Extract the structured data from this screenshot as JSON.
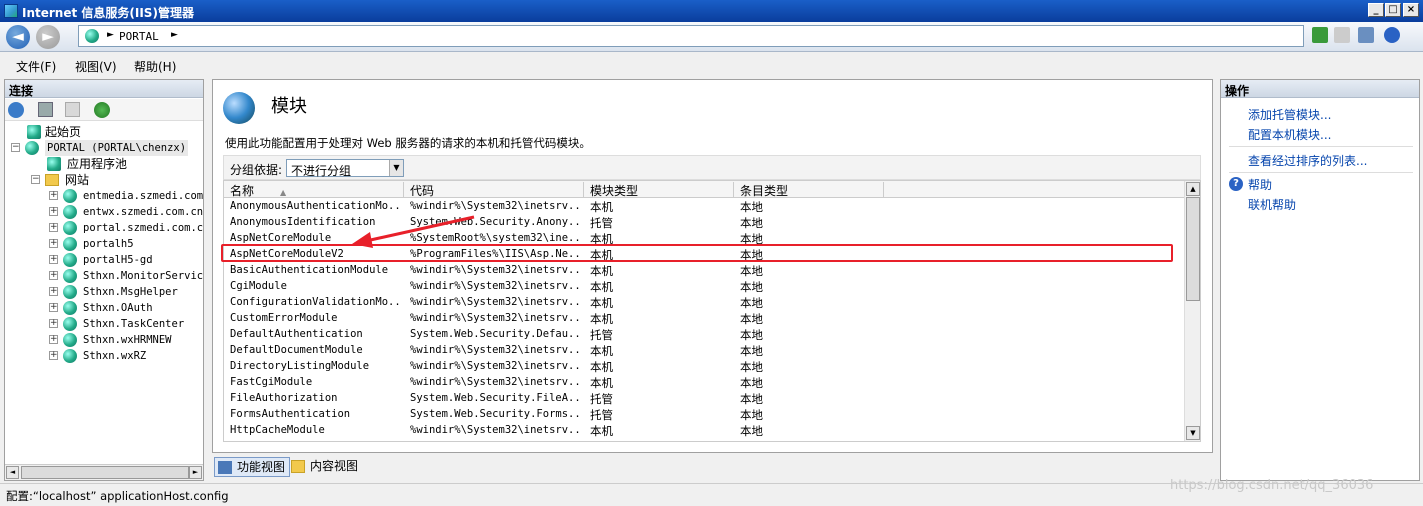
{
  "window": {
    "title": "Internet 信息服务(IIS)管理器"
  },
  "navbar": {
    "path": "PORTAL"
  },
  "menu": {
    "file": "文件(F)",
    "view": "视图(V)",
    "help": "帮助(H)"
  },
  "connections": {
    "header": "连接",
    "start_page": "起始页",
    "server": "PORTAL (PORTAL\\chenzx)",
    "app_pools": "应用程序池",
    "sites": "网站",
    "site_items": [
      "entmedia.szmedi.com.",
      "entwx.szmedi.com.cn",
      "portal.szmedi.com.cn",
      "portalh5",
      "portalH5-gd",
      "Sthxn.MonitorService",
      "Sthxn.MsgHelper",
      "Sthxn.OAuth",
      "Sthxn.TaskCenter",
      "Sthxn.wxHRMNEW",
      "Sthxn.wxRZ"
    ]
  },
  "page": {
    "title": "模块",
    "description": "使用此功能配置用于处理对 Web 服务器的请求的本机和托管代码模块。",
    "group_label": "分组依据:",
    "group_value": "不进行分组"
  },
  "grid": {
    "headers": [
      "名称",
      "代码",
      "模块类型",
      "条目类型"
    ],
    "rows": [
      [
        "AnonymousAuthenticationMo...",
        "%windir%\\System32\\inetsrv...",
        "本机",
        "本地"
      ],
      [
        "AnonymousIdentification",
        "System.Web.Security.Anony...",
        "托管",
        "本地"
      ],
      [
        "AspNetCoreModule",
        "%SystemRoot%\\system32\\ine...",
        "本机",
        "本地"
      ],
      [
        "AspNetCoreModuleV2",
        "%ProgramFiles%\\IIS\\Asp.Ne...",
        "本机",
        "本地"
      ],
      [
        "BasicAuthenticationModule",
        "%windir%\\System32\\inetsrv...",
        "本机",
        "本地"
      ],
      [
        "CgiModule",
        "%windir%\\System32\\inetsrv...",
        "本机",
        "本地"
      ],
      [
        "ConfigurationValidationMo...",
        "%windir%\\System32\\inetsrv...",
        "本机",
        "本地"
      ],
      [
        "CustomErrorModule",
        "%windir%\\System32\\inetsrv...",
        "本机",
        "本地"
      ],
      [
        "DefaultAuthentication",
        "System.Web.Security.Defau...",
        "托管",
        "本地"
      ],
      [
        "DefaultDocumentModule",
        "%windir%\\System32\\inetsrv...",
        "本机",
        "本地"
      ],
      [
        "DirectoryListingModule",
        "%windir%\\System32\\inetsrv...",
        "本机",
        "本地"
      ],
      [
        "FastCgiModule",
        "%windir%\\System32\\inetsrv...",
        "本机",
        "本地"
      ],
      [
        "FileAuthorization",
        "System.Web.Security.FileA...",
        "托管",
        "本地"
      ],
      [
        "FormsAuthentication",
        "System.Web.Security.Forms...",
        "托管",
        "本地"
      ],
      [
        "HttpCacheModule",
        "%windir%\\System32\\inetsrv...",
        "本机",
        "本地"
      ]
    ]
  },
  "view_tabs": {
    "features": "功能视图",
    "content": "内容视图"
  },
  "actions": {
    "header": "操作",
    "add_managed": "添加托管模块...",
    "configure_native": "配置本机模块...",
    "view_ordered": "查看经过排序的列表...",
    "help": "帮助",
    "online_help": "联机帮助"
  },
  "status": {
    "text": "配置:“localhost” applicationHost.config"
  },
  "watermark": "https://blog.csdn.net/qq_36036",
  "colors": {
    "highlight": "#e8202a",
    "title_bar": "#0a3d9c",
    "link": "#0645ad"
  }
}
